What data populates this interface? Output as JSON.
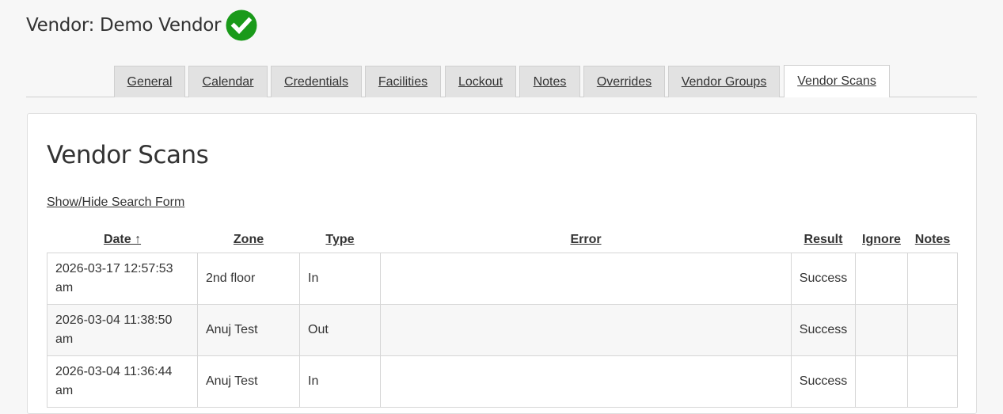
{
  "header": {
    "title": "Vendor: Demo Vendor",
    "status_icon": "check-circle-icon",
    "status_color": "#1a9a1a"
  },
  "tabs": [
    {
      "label": "General",
      "active": false
    },
    {
      "label": "Calendar",
      "active": false
    },
    {
      "label": "Credentials",
      "active": false
    },
    {
      "label": "Facilities",
      "active": false
    },
    {
      "label": "Lockout",
      "active": false
    },
    {
      "label": "Notes",
      "active": false
    },
    {
      "label": "Overrides",
      "active": false
    },
    {
      "label": "Vendor Groups",
      "active": false
    },
    {
      "label": "Vendor Scans",
      "active": true
    }
  ],
  "panel": {
    "title": "Vendor Scans",
    "search_toggle": "Show/Hide Search Form"
  },
  "table": {
    "columns": [
      {
        "label": "Date ↑"
      },
      {
        "label": "Zone"
      },
      {
        "label": "Type"
      },
      {
        "label": "Error"
      },
      {
        "label": "Result"
      },
      {
        "label": "Ignore"
      },
      {
        "label": "Notes"
      }
    ],
    "rows": [
      {
        "date": "2026-03-17 12:57:53 am",
        "zone": "2nd floor",
        "type": "In",
        "error": "",
        "result": "Success",
        "ignore": "",
        "notes": ""
      },
      {
        "date": "2026-03-04 11:38:50 am",
        "zone": "Anuj Test",
        "type": "Out",
        "error": "",
        "result": "Success",
        "ignore": "",
        "notes": ""
      },
      {
        "date": "2026-03-04 11:36:44 am",
        "zone": "Anuj Test",
        "type": "In",
        "error": "",
        "result": "Success",
        "ignore": "",
        "notes": ""
      }
    ]
  }
}
